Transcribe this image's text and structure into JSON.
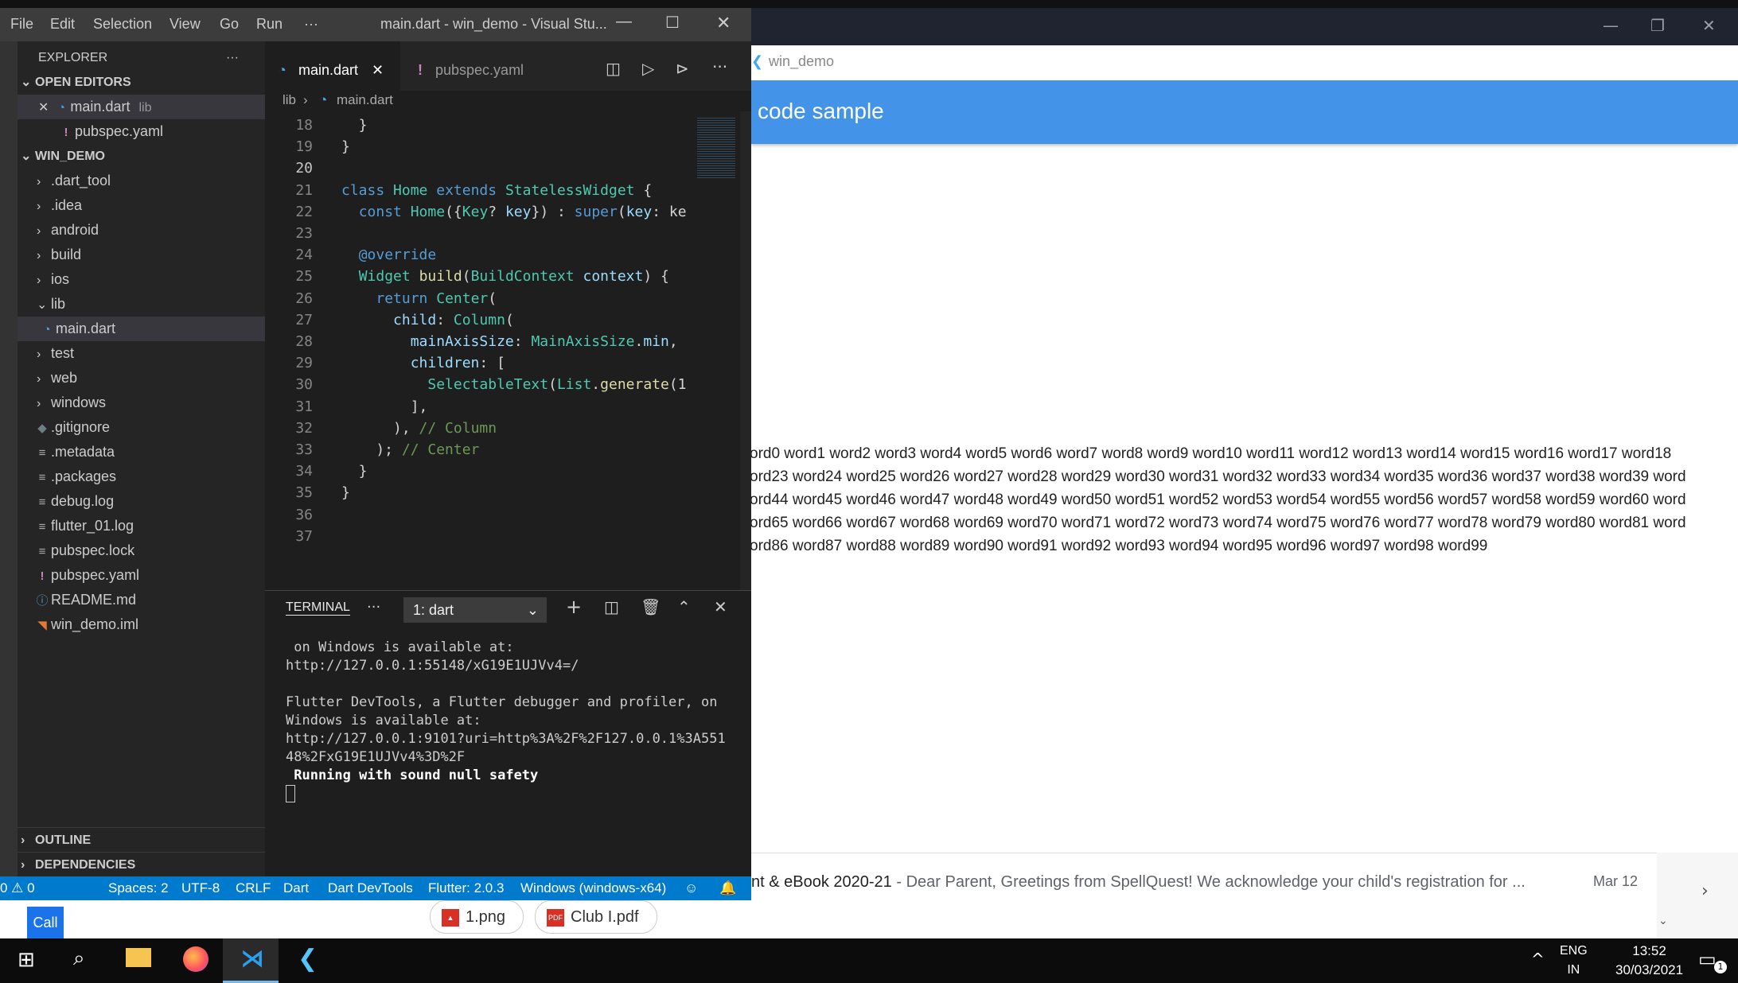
{
  "flutter": {
    "window_title": "win_demo",
    "appbar_title": "code sample",
    "word_lines": [
      "ord0 word1 word2 word3 word4 word5 word6 word7 word8 word9 word10 word11 word12 word13 word14 word15 word16 word17 word18",
      "ord23 word24 word25 word26 word27 word28 word29 word30 word31 word32 word33 word34 word35 word36 word37 word38 word39 word",
      "ord44 word45 word46 word47 word48 word49 word50 word51 word52 word53 word54 word55 word56 word57 word58 word59 word60 word",
      "ord65 word66 word67 word68 word69 word70 word71 word72 word73 word74 word75 word76 word77 word78 word79 word80 word81 word",
      "ord86 word87 word88 word89 word90 word91 word92 word93 word94 word95 word96 word97 word98 word99"
    ],
    "win_min": "—",
    "win_restore": "❐",
    "win_close": "✕"
  },
  "mail": {
    "subject": "nt & eBook 2020-21",
    "snippet": " - Dear Parent, Greetings from SpellQuest! We acknowledge your child's registration for ...",
    "date": "Mar 12"
  },
  "vscode": {
    "title": "main.dart - win_demo - Visual Stu...",
    "menu": [
      "File",
      "Edit",
      "Selection",
      "View",
      "Go",
      "Run",
      "···"
    ],
    "explorer_label": "EXPLORER",
    "open_editors_label": "OPEN EDITORS",
    "open_editors": [
      {
        "name": "main.dart",
        "detail": "lib"
      },
      {
        "name": "pubspec.yaml",
        "detail": ""
      }
    ],
    "project_label": "WIN_DEMO",
    "tree": [
      {
        "name": ".dart_tool",
        "kind": "folder"
      },
      {
        "name": ".idea",
        "kind": "folder"
      },
      {
        "name": "android",
        "kind": "folder"
      },
      {
        "name": "build",
        "kind": "folder"
      },
      {
        "name": "ios",
        "kind": "folder"
      },
      {
        "name": "lib",
        "kind": "folder-open"
      },
      {
        "name": "main.dart",
        "kind": "dart"
      },
      {
        "name": "test",
        "kind": "folder"
      },
      {
        "name": "web",
        "kind": "folder"
      },
      {
        "name": "windows",
        "kind": "folder"
      },
      {
        "name": ".gitignore",
        "kind": "git"
      },
      {
        "name": ".metadata",
        "kind": "text"
      },
      {
        "name": ".packages",
        "kind": "text"
      },
      {
        "name": "debug.log",
        "kind": "text"
      },
      {
        "name": "flutter_01.log",
        "kind": "text"
      },
      {
        "name": "pubspec.lock",
        "kind": "text"
      },
      {
        "name": "pubspec.yaml",
        "kind": "yaml"
      },
      {
        "name": "README.md",
        "kind": "info"
      },
      {
        "name": "win_demo.iml",
        "kind": "rss"
      }
    ],
    "outline_label": "OUTLINE",
    "dependencies_label": "DEPENDENCIES",
    "tabs": [
      {
        "label": "main.dart"
      },
      {
        "label": "pubspec.yaml"
      }
    ],
    "breadcrumb": [
      "lib",
      "main.dart"
    ],
    "code_lines": [
      {
        "n": "18",
        "t": "  }"
      },
      {
        "n": "19",
        "t": "}"
      },
      {
        "n": "20",
        "t": ""
      },
      {
        "n": "21",
        "t": "class Home extends StatelessWidget {"
      },
      {
        "n": "22",
        "t": "  const Home({Key? key}) : super(key: ke"
      },
      {
        "n": "23",
        "t": ""
      },
      {
        "n": "24",
        "t": "  @override"
      },
      {
        "n": "25",
        "t": "  Widget build(BuildContext context) {"
      },
      {
        "n": "26",
        "t": "    return Center("
      },
      {
        "n": "27",
        "t": "      child: Column("
      },
      {
        "n": "28",
        "t": "        mainAxisSize: MainAxisSize.min,"
      },
      {
        "n": "29",
        "t": "        children: ["
      },
      {
        "n": "30",
        "t": "          SelectableText(List.generate(1"
      },
      {
        "n": "31",
        "t": "        ],"
      },
      {
        "n": "32",
        "t": "      ), // Column"
      },
      {
        "n": "33",
        "t": "    ); // Center"
      },
      {
        "n": "34",
        "t": "  }"
      },
      {
        "n": "35",
        "t": "}"
      },
      {
        "n": "36",
        "t": ""
      },
      {
        "n": "37",
        "t": ""
      }
    ],
    "terminal": {
      "tab_label": "TERMINAL",
      "dropdown": "1: dart",
      "output": " on Windows is available at:\nhttp://127.0.0.1:55148/xG19E1UJVv4=/\n\nFlutter DevTools, a Flutter debugger and profiler, on\nWindows is available at:\nhttp://127.0.0.1:9101?uri=http%3A%2F%2F127.0.0.1%3A551\n48%2FxG19E1UJVv4%3D%2F\n",
      "bold_line": " Running with sound null safety"
    },
    "status": {
      "problems": "0 ⚠ 0",
      "spaces": "Spaces: 2",
      "encoding": "UTF-8",
      "eol": "CRLF",
      "language": "Dart",
      "devtools": "Dart DevTools",
      "flutter": "Flutter: 2.0.3",
      "device": "Windows (windows-x64)"
    }
  },
  "downloads": [
    {
      "label": "1.png",
      "type": "image"
    },
    {
      "label": "Club I.pdf",
      "type": "pdf"
    }
  ],
  "partial_button": "Call",
  "taskbar": {
    "lang_line1": "ENG",
    "lang_line2": "IN",
    "time": "13:52",
    "date": "30/03/2021",
    "notif_count": "1"
  }
}
